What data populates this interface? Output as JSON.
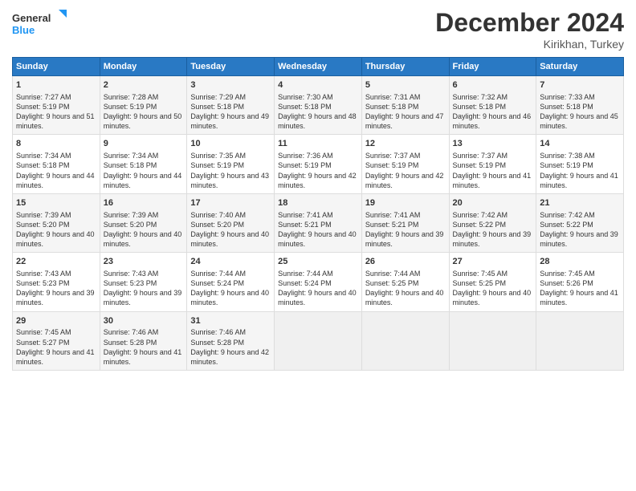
{
  "logo": {
    "line1": "General",
    "line2": "Blue"
  },
  "title": "December 2024",
  "location": "Kirikhan, Turkey",
  "days_of_week": [
    "Sunday",
    "Monday",
    "Tuesday",
    "Wednesday",
    "Thursday",
    "Friday",
    "Saturday"
  ],
  "weeks": [
    [
      {
        "day": 1,
        "sunrise": "7:27 AM",
        "sunset": "5:19 PM",
        "daylight": "9 hours and 51 minutes."
      },
      {
        "day": 2,
        "sunrise": "7:28 AM",
        "sunset": "5:19 PM",
        "daylight": "9 hours and 50 minutes."
      },
      {
        "day": 3,
        "sunrise": "7:29 AM",
        "sunset": "5:18 PM",
        "daylight": "9 hours and 49 minutes."
      },
      {
        "day": 4,
        "sunrise": "7:30 AM",
        "sunset": "5:18 PM",
        "daylight": "9 hours and 48 minutes."
      },
      {
        "day": 5,
        "sunrise": "7:31 AM",
        "sunset": "5:18 PM",
        "daylight": "9 hours and 47 minutes."
      },
      {
        "day": 6,
        "sunrise": "7:32 AM",
        "sunset": "5:18 PM",
        "daylight": "9 hours and 46 minutes."
      },
      {
        "day": 7,
        "sunrise": "7:33 AM",
        "sunset": "5:18 PM",
        "daylight": "9 hours and 45 minutes."
      }
    ],
    [
      {
        "day": 8,
        "sunrise": "7:34 AM",
        "sunset": "5:18 PM",
        "daylight": "9 hours and 44 minutes."
      },
      {
        "day": 9,
        "sunrise": "7:34 AM",
        "sunset": "5:18 PM",
        "daylight": "9 hours and 44 minutes."
      },
      {
        "day": 10,
        "sunrise": "7:35 AM",
        "sunset": "5:19 PM",
        "daylight": "9 hours and 43 minutes."
      },
      {
        "day": 11,
        "sunrise": "7:36 AM",
        "sunset": "5:19 PM",
        "daylight": "9 hours and 42 minutes."
      },
      {
        "day": 12,
        "sunrise": "7:37 AM",
        "sunset": "5:19 PM",
        "daylight": "9 hours and 42 minutes."
      },
      {
        "day": 13,
        "sunrise": "7:37 AM",
        "sunset": "5:19 PM",
        "daylight": "9 hours and 41 minutes."
      },
      {
        "day": 14,
        "sunrise": "7:38 AM",
        "sunset": "5:19 PM",
        "daylight": "9 hours and 41 minutes."
      }
    ],
    [
      {
        "day": 15,
        "sunrise": "7:39 AM",
        "sunset": "5:20 PM",
        "daylight": "9 hours and 40 minutes."
      },
      {
        "day": 16,
        "sunrise": "7:39 AM",
        "sunset": "5:20 PM",
        "daylight": "9 hours and 40 minutes."
      },
      {
        "day": 17,
        "sunrise": "7:40 AM",
        "sunset": "5:20 PM",
        "daylight": "9 hours and 40 minutes."
      },
      {
        "day": 18,
        "sunrise": "7:41 AM",
        "sunset": "5:21 PM",
        "daylight": "9 hours and 40 minutes."
      },
      {
        "day": 19,
        "sunrise": "7:41 AM",
        "sunset": "5:21 PM",
        "daylight": "9 hours and 39 minutes."
      },
      {
        "day": 20,
        "sunrise": "7:42 AM",
        "sunset": "5:22 PM",
        "daylight": "9 hours and 39 minutes."
      },
      {
        "day": 21,
        "sunrise": "7:42 AM",
        "sunset": "5:22 PM",
        "daylight": "9 hours and 39 minutes."
      }
    ],
    [
      {
        "day": 22,
        "sunrise": "7:43 AM",
        "sunset": "5:23 PM",
        "daylight": "9 hours and 39 minutes."
      },
      {
        "day": 23,
        "sunrise": "7:43 AM",
        "sunset": "5:23 PM",
        "daylight": "9 hours and 39 minutes."
      },
      {
        "day": 24,
        "sunrise": "7:44 AM",
        "sunset": "5:24 PM",
        "daylight": "9 hours and 40 minutes."
      },
      {
        "day": 25,
        "sunrise": "7:44 AM",
        "sunset": "5:24 PM",
        "daylight": "9 hours and 40 minutes."
      },
      {
        "day": 26,
        "sunrise": "7:44 AM",
        "sunset": "5:25 PM",
        "daylight": "9 hours and 40 minutes."
      },
      {
        "day": 27,
        "sunrise": "7:45 AM",
        "sunset": "5:25 PM",
        "daylight": "9 hours and 40 minutes."
      },
      {
        "day": 28,
        "sunrise": "7:45 AM",
        "sunset": "5:26 PM",
        "daylight": "9 hours and 41 minutes."
      }
    ],
    [
      {
        "day": 29,
        "sunrise": "7:45 AM",
        "sunset": "5:27 PM",
        "daylight": "9 hours and 41 minutes."
      },
      {
        "day": 30,
        "sunrise": "7:46 AM",
        "sunset": "5:28 PM",
        "daylight": "9 hours and 41 minutes."
      },
      {
        "day": 31,
        "sunrise": "7:46 AM",
        "sunset": "5:28 PM",
        "daylight": "9 hours and 42 minutes."
      },
      null,
      null,
      null,
      null
    ]
  ]
}
